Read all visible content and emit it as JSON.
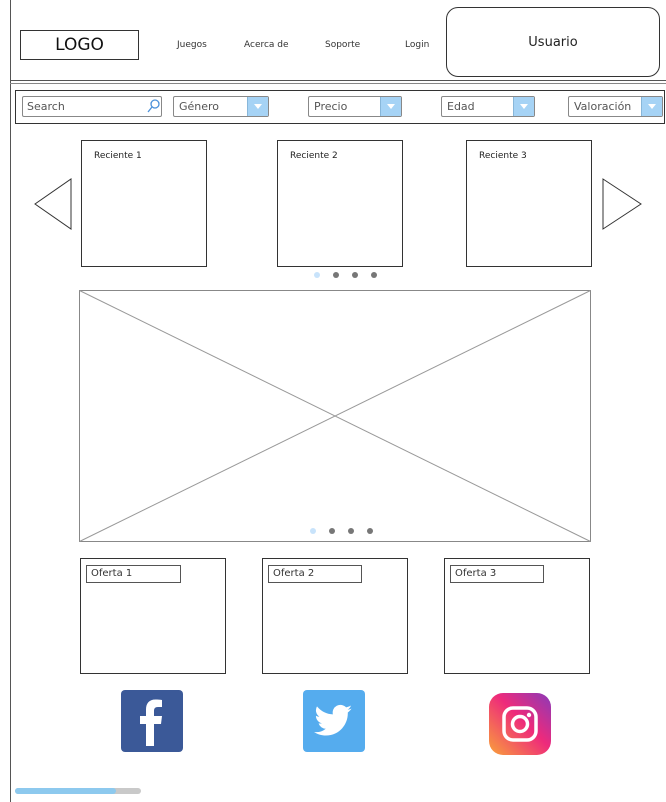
{
  "header": {
    "logo": "LOGO",
    "nav": [
      "Juegos",
      "Acerca de",
      "Soporte",
      "Login"
    ],
    "user": "Usuario"
  },
  "filters": {
    "search_placeholder": "Search",
    "selects": [
      "Género",
      "Precio",
      "Edad",
      "Valoración"
    ]
  },
  "recent": {
    "items": [
      "Reciente 1",
      "Reciente 2",
      "Reciente 3"
    ],
    "dots": 4,
    "active_dot": 0
  },
  "banner": {
    "dots": 4,
    "active_dot": 0
  },
  "offers": [
    "Oferta 1",
    "Oferta 2",
    "Oferta 3"
  ],
  "social": [
    {
      "name": "facebook",
      "icon": "facebook-icon",
      "color": "#3b5998"
    },
    {
      "name": "twitter",
      "icon": "twitter-icon",
      "color": "#55acee"
    },
    {
      "name": "instagram",
      "icon": "instagram-icon",
      "color": "#ee2a7b"
    }
  ],
  "scroll": {
    "progress": 0.8
  }
}
